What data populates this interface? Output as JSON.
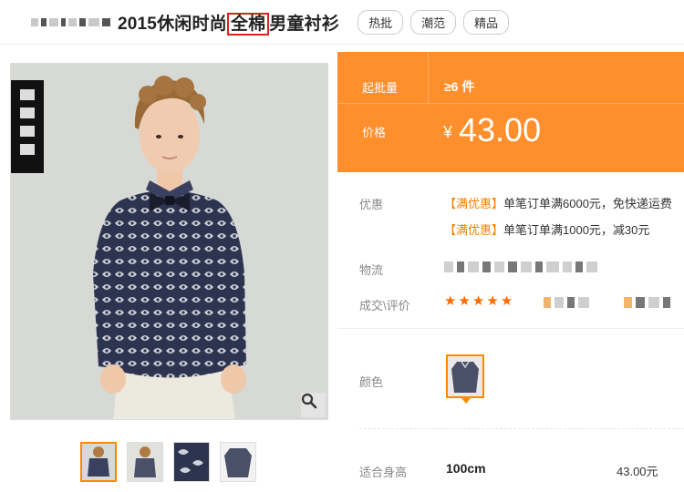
{
  "header": {
    "title_prefix": "2015休闲时尚",
    "title_highlight": "全棉",
    "title_suffix": "男童衬衫",
    "tags": [
      "热批",
      "潮范",
      "精品"
    ]
  },
  "product": {
    "min_batch_label": "起批量",
    "min_batch_value": "≥6 件",
    "price_label": "价格",
    "price_symbol": "¥",
    "price_value": "43.00"
  },
  "info": {
    "promo_label": "优惠",
    "promos": [
      {
        "badge": "【满优惠】",
        "text": "单笔订单满6000元，免快递运费"
      },
      {
        "badge": "【满优惠】",
        "text": "单笔订单满1000元，减30元"
      }
    ],
    "logistics_label": "物流",
    "reviews_label": "成交\\评价",
    "stars": [
      "★",
      "★",
      "★",
      "★",
      "★"
    ]
  },
  "options": {
    "color_label": "颜色",
    "size_label": "适合身高",
    "size_value": "100cm",
    "size_price": "43.00元"
  },
  "colors": {
    "accent": "#ff8e2c",
    "highlight_box": "#e0201c",
    "promo_badge": "#f08200",
    "star": "#ff6a00"
  },
  "icons": {
    "zoom": "magnifier-icon",
    "star": "star-icon",
    "arrow": "caret-down-icon"
  }
}
